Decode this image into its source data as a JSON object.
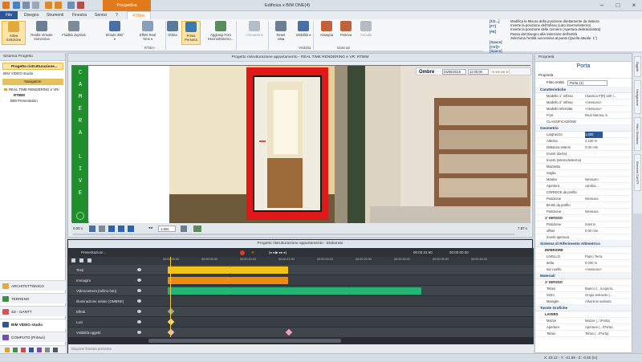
{
  "titlebar": {
    "context_tab": "Prospettiva",
    "title": "Edificius x BIM ONE(4)"
  },
  "menu": {
    "file": "File",
    "tabs": [
      "Disegno",
      "Strumenti",
      "Finestra",
      "Servizi",
      "?"
    ],
    "active_tab": "RTBim"
  },
  "ribbon": {
    "buttons": [
      {
        "label": "Attiva Selezione",
        "sel": true
      },
      {
        "label": "Realtà Virtuale Immersiva"
      },
      {
        "label": "Fluidità Joystick"
      },
      {
        "label": "Sfondo 360° ▾"
      },
      {
        "label": "Effetti Real Time ▾"
      },
      {
        "label": "Orbita"
      },
      {
        "label": "Prima Persona",
        "sel": true
      },
      {
        "label": "Aggiungi Foto Interno/Esterno..."
      },
      {
        "label": "Animazione",
        "dis": true
      },
      {
        "label": "Reset vista"
      },
      {
        "label": "Visibilità ▾"
      },
      {
        "label": "Assegna"
      },
      {
        "label": "Preleva"
      },
      {
        "label": "Annulla",
        "dis": true
      }
    ],
    "groups": [
      "RTBim",
      "Visibilità",
      "Materiali"
    ]
  },
  "help": {
    "keys": [
      "[1/2...]",
      "[F7]",
      "[F8]",
      "",
      "[Space]",
      "[Ctrl]+[Space]"
    ],
    "lines": [
      "Modifica la Misura della posizione direttamente da tastiera",
      "Inverte la posizione dell'infisso (Lato interno/esterno)",
      "Inverte la posizione delle cerniere (Apertura destra/sinistra)",
      "Passa dal Disegno alla Selezione dell'entità",
      "Seleziona l'entità successiva al punto (Quella attuale: 1°)"
    ]
  },
  "left_panel": {
    "header": "Sistema Progetto",
    "project": "Progetto ristrutturazione...",
    "bim_label": "BIM VIDEO studio",
    "navigator": "Navigatore",
    "tree": [
      "REAL TIME RENDERING e VR/",
      "RTBIM",
      "BIM Presentation"
    ],
    "nav": [
      {
        "label": "ARCHITETTONICO",
        "color": "#e2a93b"
      },
      {
        "label": "TERRENO",
        "color": "#3e8f3e"
      },
      {
        "label": "4D - GANTT",
        "color": "#d9534f"
      },
      {
        "label": "BIM VIDEO studio",
        "color": "#2b5797",
        "active": true
      },
      {
        "label": "COMPUTO (PriMus)",
        "color": "#7a4ab0"
      }
    ]
  },
  "viewport": {
    "title": "Progetto ristrutturazione appartamento - REAL TIME RENDERING e VR: RTBIM",
    "cam_letters": [
      "C",
      "A",
      "M",
      "E",
      "R",
      "A",
      "",
      "L",
      "I",
      "V",
      "E"
    ],
    "shadow_label": "Ombre",
    "date": "04/06/2019",
    "time": "11:00:00",
    "speed": "1.00s",
    "left_readout": "0.00 s",
    "right_readout": "7.87 s"
  },
  "timeline": {
    "title": "Progetto ristrutturazione appartamento - Elaborato",
    "presentation": "Presentazioni...",
    "time_display": "00:00:22.60",
    "time_display2": "00:00:00.00",
    "marks": [
      "00:00:00.00",
      "00:00:05.00",
      "00:00:10.00",
      "00:00:15.00",
      "00:00:20.00",
      "00:00:25.00",
      "00:00:30.00",
      "00:00:35.00",
      "00:00:40.00"
    ],
    "tracks": [
      "Testi",
      "Immagini",
      "Videocamera (rullino foto)",
      "Illuminazione solare (OMBRE)",
      "Effetti",
      "Luci",
      "Visibilità oggetti"
    ],
    "footer": "Dispone finestra presente"
  },
  "props": {
    "header": "Proprietà",
    "title": "Porta",
    "tab": "Proprietà",
    "filter_label": "Filtro entità",
    "filter_value": "Porta (1)",
    "rows": [
      {
        "t": "sect",
        "k": "Caratteristiche"
      },
      {
        "k": "Modello 1° infisso",
        "v": "Classica P[R] 180 (..."
      },
      {
        "k": "Modello 2° infisso",
        "v": "<nessuno>"
      },
      {
        "k": "Modello Inferriata",
        "v": "<nessuno>"
      },
      {
        "k": "Font",
        "v": "Real Narrow, 6"
      },
      {
        "k": "CLASSIFICAZIONE",
        "v": ""
      },
      {
        "t": "sect",
        "k": "Geometria"
      },
      {
        "k": "Larghezza",
        "v": "1.000"
      },
      {
        "k": "Altezza",
        "v": "2.100 m"
      },
      {
        "k": "Distanza esterni",
        "v": "0.00 mm"
      },
      {
        "k": "Inverti (dx/sn)",
        "v": ""
      },
      {
        "k": "Inverti (interno/esterno)",
        "v": ""
      },
      {
        "k": "Mazzetta",
        "v": ""
      },
      {
        "k": "Soglia",
        "v": ""
      },
      {
        "k": "Mostra",
        "v": "Nessuno"
      },
      {
        "k": "Apertura",
        "v": "cambia..."
      },
      {
        "k": "CORNICE da profilo",
        "v": ""
      },
      {
        "k": "Posizione",
        "v": "Nessuna"
      },
      {
        "k": "BASE da profilo",
        "v": ""
      },
      {
        "k": "Posizione",
        "v": "Nessuna"
      },
      {
        "t": "sub",
        "k": "1° INFISSO"
      },
      {
        "k": "Posizione",
        "v": "Interno"
      },
      {
        "k": "offset",
        "v": "0.00 mm"
      },
      {
        "k": "Inverti apertura",
        "v": ""
      },
      {
        "t": "sect",
        "k": "Sistema di Riferimento Altimetrico"
      },
      {
        "t": "sub",
        "k": "INFERIORE"
      },
      {
        "k": "LIVELLO",
        "v": "Piano Terra"
      },
      {
        "k": "delta",
        "v": "0.000 m"
      },
      {
        "k": "sul Livello",
        "v": "<nessuno>"
      },
      {
        "t": "sect",
        "k": "Materiali"
      },
      {
        "t": "sub",
        "k": "1° INFISSO"
      },
      {
        "k": "Telaio",
        "v": "Bianco (...\\Legno\\L"
      },
      {
        "k": "Vetro",
        "v": "Grigio antracite (..."
      },
      {
        "k": "Maniglie",
        "v": "Alluminio satinato"
      },
      {
        "t": "sect",
        "k": "Tavole Grafiche"
      },
      {
        "t": "sub",
        "k": "LAYERS"
      },
      {
        "k": "Mazze",
        "v": "Mazze (...\\Porta)"
      },
      {
        "k": "Aperture",
        "v": "Aperture (...\\Porta)"
      },
      {
        "k": "Telaio",
        "v": "Telaio (...\\Porta)"
      }
    ]
  },
  "sidetabs": [
    "Oggetti",
    "Navigazione",
    "Filtro Sfondano",
    "Elementi GANTT"
  ],
  "status": "X: 23.12 - Y: -21.89 - Z: -0.50 (m)"
}
